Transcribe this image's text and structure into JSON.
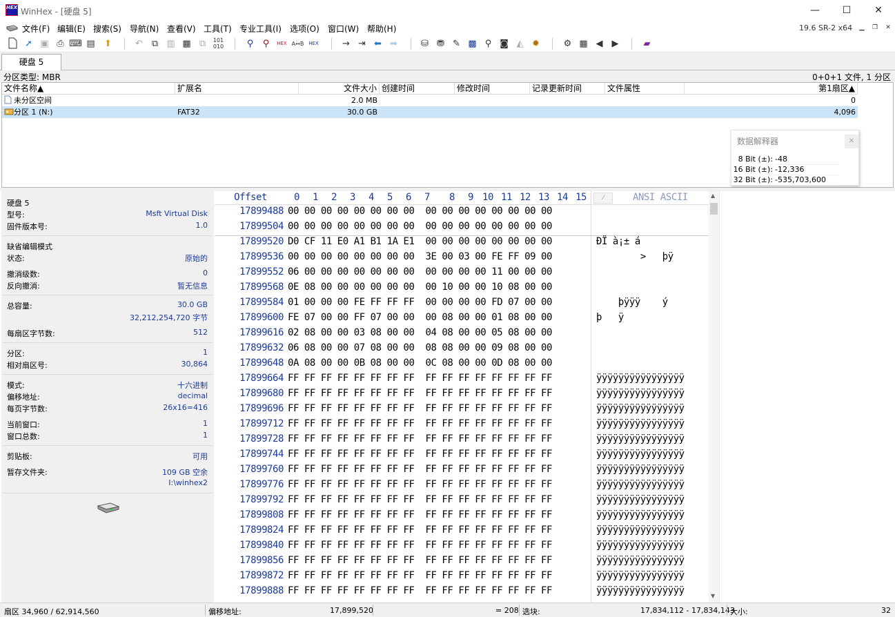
{
  "window": {
    "title": "WinHex - [硬盘 5]",
    "logo_text": "HEX",
    "minimize_label": "—",
    "maximize_label": "☐",
    "close_label": "✕"
  },
  "menu": {
    "items": [
      "文件(F)",
      "编辑(E)",
      "搜索(S)",
      "导航(N)",
      "查看(V)",
      "工具(T)",
      "专业工具(I)",
      "选项(O)",
      "窗口(W)",
      "帮助(H)"
    ],
    "version": "19.6 SR-2 x64"
  },
  "toolbar": {
    "icons": [
      "new-file-icon",
      "open-file-icon",
      "save-icon",
      "print-icon",
      "printer-icon",
      "properties-icon",
      "export-icon",
      "undo-icon",
      "copy-icon",
      "copy-block-icon",
      "paste-icon",
      "paste-special-icon",
      "binary-icon",
      "find-icon",
      "find-replace-icon",
      "find-hex-icon",
      "replace-hex-icon",
      "replace-hex-2-icon",
      "goto-offset-icon",
      "goto-sector-icon",
      "back-icon",
      "forward-icon",
      "open-disk-icon",
      "disk-clone-icon",
      "disk-tools-icon",
      "ram-icon",
      "disk-search-icon",
      "disk-icon",
      "snapshot-icon",
      "settings-icon",
      "case-icon",
      "calc-icon",
      "prev-icon",
      "next-icon",
      "help-book-icon"
    ]
  },
  "tab": {
    "label": "硬盘 5"
  },
  "partition_bar": {
    "type_label": "分区类型: MBR",
    "count_label": "0+0+1 文件, 1 分区"
  },
  "file_list": {
    "columns": [
      "文件名称▲",
      "扩展名",
      "文件大小",
      "创建时间",
      "修改时间",
      "记录更新时间",
      "文件属性",
      "第1扇区▲"
    ],
    "rows": [
      {
        "name": "未分区空间",
        "ext": "",
        "size": "2.0 MB",
        "first_sector": "0"
      },
      {
        "name": "分区 1 (N:)",
        "ext": "FAT32",
        "size": "30.0 GB",
        "first_sector": "4,096"
      }
    ]
  },
  "interpreter": {
    "title": "数据解释器",
    "close_label": "✕",
    "rows": [
      {
        "label": "8 Bit (±):",
        "value": "-48"
      },
      {
        "label": "16 Bit (±):",
        "value": "-12,336"
      },
      {
        "label": "32 Bit (±):",
        "value": "-535,703,600"
      }
    ]
  },
  "info_panel": {
    "disk_name": "硬盘 5",
    "model_label": "型号:",
    "model_value": "Msft Virtual Disk",
    "firmware_label": "固件版本号:",
    "firmware_value": "1.0",
    "edit_mode_label": "缺省编辑模式",
    "state_label": "状态:",
    "state_value": "原始的",
    "undo_levels_label": "撤消级数:",
    "undo_levels_value": "0",
    "reverse_undo_label": "反向撤消:",
    "reverse_undo_value": "暂无信息",
    "capacity_label": "总容量:",
    "capacity_value": "30.0 GB",
    "capacity_bytes": "32,212,254,720 字节",
    "bytes_per_sector_label": "每扇区字节数:",
    "bytes_per_sector_value": "512",
    "partition_label": "分区:",
    "partition_value": "1",
    "relative_sector_label": "相对扇区号:",
    "relative_sector_value": "30,864",
    "mode_label": "模式:",
    "mode_value": "十六进制",
    "offset_addr_label": "偏移地址:",
    "offset_addr_value": "decimal",
    "bytes_per_page_label": "每页字节数:",
    "bytes_per_page_value": "26x16=416",
    "current_window_label": "当前窗口:",
    "current_window_value": "1",
    "total_windows_label": "窗口总数:",
    "total_windows_value": "1",
    "clipboard_label": "剪贴板:",
    "clipboard_value": "可用",
    "temp_folder_label": "暂存文件夹:",
    "temp_folder_value": "109 GB 空余",
    "temp_folder_path": "I:\\winhex2"
  },
  "hex_view": {
    "offset_header": "Offset",
    "column_headers": [
      "0",
      "1",
      "2",
      "3",
      "4",
      "5",
      "6",
      "7",
      "8",
      "9",
      "10",
      "11",
      "12",
      "13",
      "14",
      "15"
    ],
    "ascii_header": "ANSI ASCII",
    "ascii_dropdown_label": "⁄",
    "rows": [
      {
        "offset": "17899488",
        "hex": "00 00 00 00 00 00 00 00  00 00 00 00 00 00 00 00",
        "ascii": ""
      },
      {
        "offset": "17899504",
        "hex": "00 00 00 00 00 00 00 00  00 00 00 00 00 00 00 00",
        "ascii": ""
      },
      {
        "offset": "17899520",
        "hex": "D0 CF 11 E0 A1 B1 1A E1  00 00 00 00 00 00 00 00",
        "ascii": "ÐÏ à¡± á"
      },
      {
        "offset": "17899536",
        "hex": "00 00 00 00 00 00 00 00  3E 00 03 00 FE FF 09 00",
        "ascii": "        >   þÿ"
      },
      {
        "offset": "17899552",
        "hex": "06 00 00 00 00 00 00 00  00 00 00 00 11 00 00 00",
        "ascii": ""
      },
      {
        "offset": "17899568",
        "hex": "0E 08 00 00 00 00 00 00  00 10 00 00 10 08 00 00",
        "ascii": ""
      },
      {
        "offset": "17899584",
        "hex": "01 00 00 00 FE FF FF FF  00 00 00 00 FD 07 00 00",
        "ascii": "    þÿÿÿ    ý"
      },
      {
        "offset": "17899600",
        "hex": "FE 07 00 00 FF 07 00 00  00 08 00 00 01 08 00 00",
        "ascii": "þ   ÿ"
      },
      {
        "offset": "17899616",
        "hex": "02 08 00 00 03 08 00 00  04 08 00 00 05 08 00 00",
        "ascii": ""
      },
      {
        "offset": "17899632",
        "hex": "06 08 00 00 07 08 00 00  08 08 00 00 09 08 00 00",
        "ascii": ""
      },
      {
        "offset": "17899648",
        "hex": "0A 08 00 00 0B 08 00 00  0C 08 00 00 0D 08 00 00",
        "ascii": ""
      },
      {
        "offset": "17899664",
        "hex": "FF FF FF FF FF FF FF FF  FF FF FF FF FF FF FF FF",
        "ascii": "ÿÿÿÿÿÿÿÿÿÿÿÿÿÿÿÿ"
      },
      {
        "offset": "17899680",
        "hex": "FF FF FF FF FF FF FF FF  FF FF FF FF FF FF FF FF",
        "ascii": "ÿÿÿÿÿÿÿÿÿÿÿÿÿÿÿÿ"
      },
      {
        "offset": "17899696",
        "hex": "FF FF FF FF FF FF FF FF  FF FF FF FF FF FF FF FF",
        "ascii": "ÿÿÿÿÿÿÿÿÿÿÿÿÿÿÿÿ"
      },
      {
        "offset": "17899712",
        "hex": "FF FF FF FF FF FF FF FF  FF FF FF FF FF FF FF FF",
        "ascii": "ÿÿÿÿÿÿÿÿÿÿÿÿÿÿÿÿ"
      },
      {
        "offset": "17899728",
        "hex": "FF FF FF FF FF FF FF FF  FF FF FF FF FF FF FF FF",
        "ascii": "ÿÿÿÿÿÿÿÿÿÿÿÿÿÿÿÿ"
      },
      {
        "offset": "17899744",
        "hex": "FF FF FF FF FF FF FF FF  FF FF FF FF FF FF FF FF",
        "ascii": "ÿÿÿÿÿÿÿÿÿÿÿÿÿÿÿÿ"
      },
      {
        "offset": "17899760",
        "hex": "FF FF FF FF FF FF FF FF  FF FF FF FF FF FF FF FF",
        "ascii": "ÿÿÿÿÿÿÿÿÿÿÿÿÿÿÿÿ"
      },
      {
        "offset": "17899776",
        "hex": "FF FF FF FF FF FF FF FF  FF FF FF FF FF FF FF FF",
        "ascii": "ÿÿÿÿÿÿÿÿÿÿÿÿÿÿÿÿ"
      },
      {
        "offset": "17899792",
        "hex": "FF FF FF FF FF FF FF FF  FF FF FF FF FF FF FF FF",
        "ascii": "ÿÿÿÿÿÿÿÿÿÿÿÿÿÿÿÿ"
      },
      {
        "offset": "17899808",
        "hex": "FF FF FF FF FF FF FF FF  FF FF FF FF FF FF FF FF",
        "ascii": "ÿÿÿÿÿÿÿÿÿÿÿÿÿÿÿÿ"
      },
      {
        "offset": "17899824",
        "hex": "FF FF FF FF FF FF FF FF  FF FF FF FF FF FF FF FF",
        "ascii": "ÿÿÿÿÿÿÿÿÿÿÿÿÿÿÿÿ"
      },
      {
        "offset": "17899840",
        "hex": "FF FF FF FF FF FF FF FF  FF FF FF FF FF FF FF FF",
        "ascii": "ÿÿÿÿÿÿÿÿÿÿÿÿÿÿÿÿ"
      },
      {
        "offset": "17899856",
        "hex": "FF FF FF FF FF FF FF FF  FF FF FF FF FF FF FF FF",
        "ascii": "ÿÿÿÿÿÿÿÿÿÿÿÿÿÿÿÿ"
      },
      {
        "offset": "17899872",
        "hex": "FF FF FF FF FF FF FF FF  FF FF FF FF FF FF FF FF",
        "ascii": "ÿÿÿÿÿÿÿÿÿÿÿÿÿÿÿÿ"
      },
      {
        "offset": "17899888",
        "hex": "FF FF FF FF FF FF FF FF  FF FF FF FF FF FF FF FF",
        "ascii": "ÿÿÿÿÿÿÿÿÿÿÿÿÿÿÿÿ"
      }
    ]
  },
  "status_bar": {
    "sector": "扇区 34,960 / 62,914,560",
    "offset_label": "偏移地址:",
    "offset_value": "17,899,520",
    "value": "= 208",
    "selection_label": "选块:",
    "selection_value": "17,834,112 - 17,834,143",
    "size_label": "大小:",
    "size_value": "32"
  },
  "colors": {
    "accent": "#1a3a9c",
    "selected_row": "#cce4f7"
  }
}
